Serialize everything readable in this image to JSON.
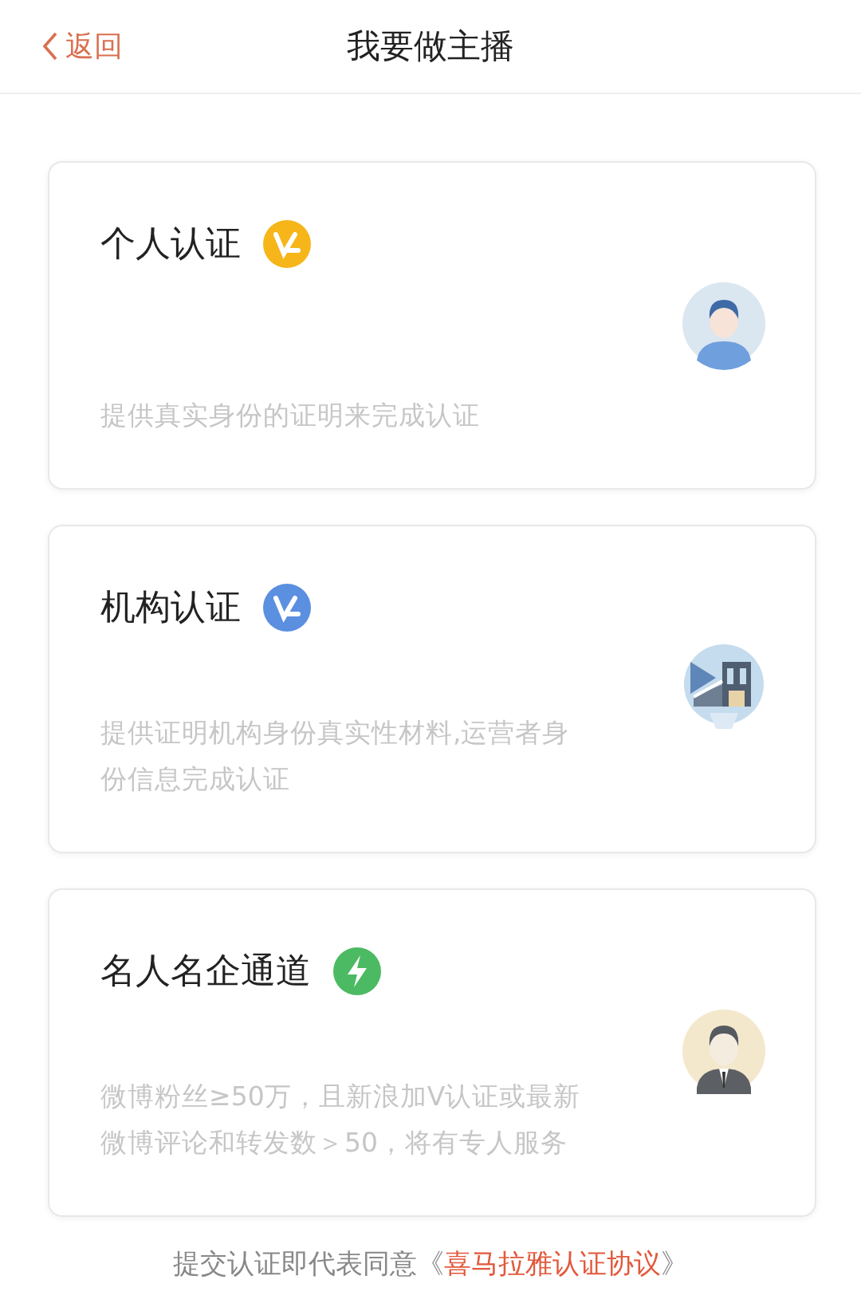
{
  "header": {
    "back_label": "返回",
    "title": "我要做主播"
  },
  "cards": [
    {
      "title": "个人认证",
      "badge": {
        "kind": "verified",
        "color": "#f6b619"
      },
      "illustration": {
        "kind": "person"
      },
      "description_lines": [
        "提供真实身份的证明来完成认证"
      ]
    },
    {
      "title": "机构认证",
      "badge": {
        "kind": "verified",
        "color": "#5b8fe0"
      },
      "illustration": {
        "kind": "building"
      },
      "description_lines": [
        "提供证明机构身份真实性材料,运营者身",
        "份信息完成认证"
      ]
    },
    {
      "title": "名人名企通道",
      "badge": {
        "kind": "bolt",
        "color": "#4cba62"
      },
      "illustration": {
        "kind": "business-person"
      },
      "description_lines": [
        "微博粉丝≥50万，且新浪加V认证或最新",
        "微博评论和转发数＞50，将有专人服务"
      ]
    }
  ],
  "footer": {
    "prefix": "提交认证即代表同意《",
    "link": "喜马拉雅认证协议",
    "suffix": "》"
  }
}
